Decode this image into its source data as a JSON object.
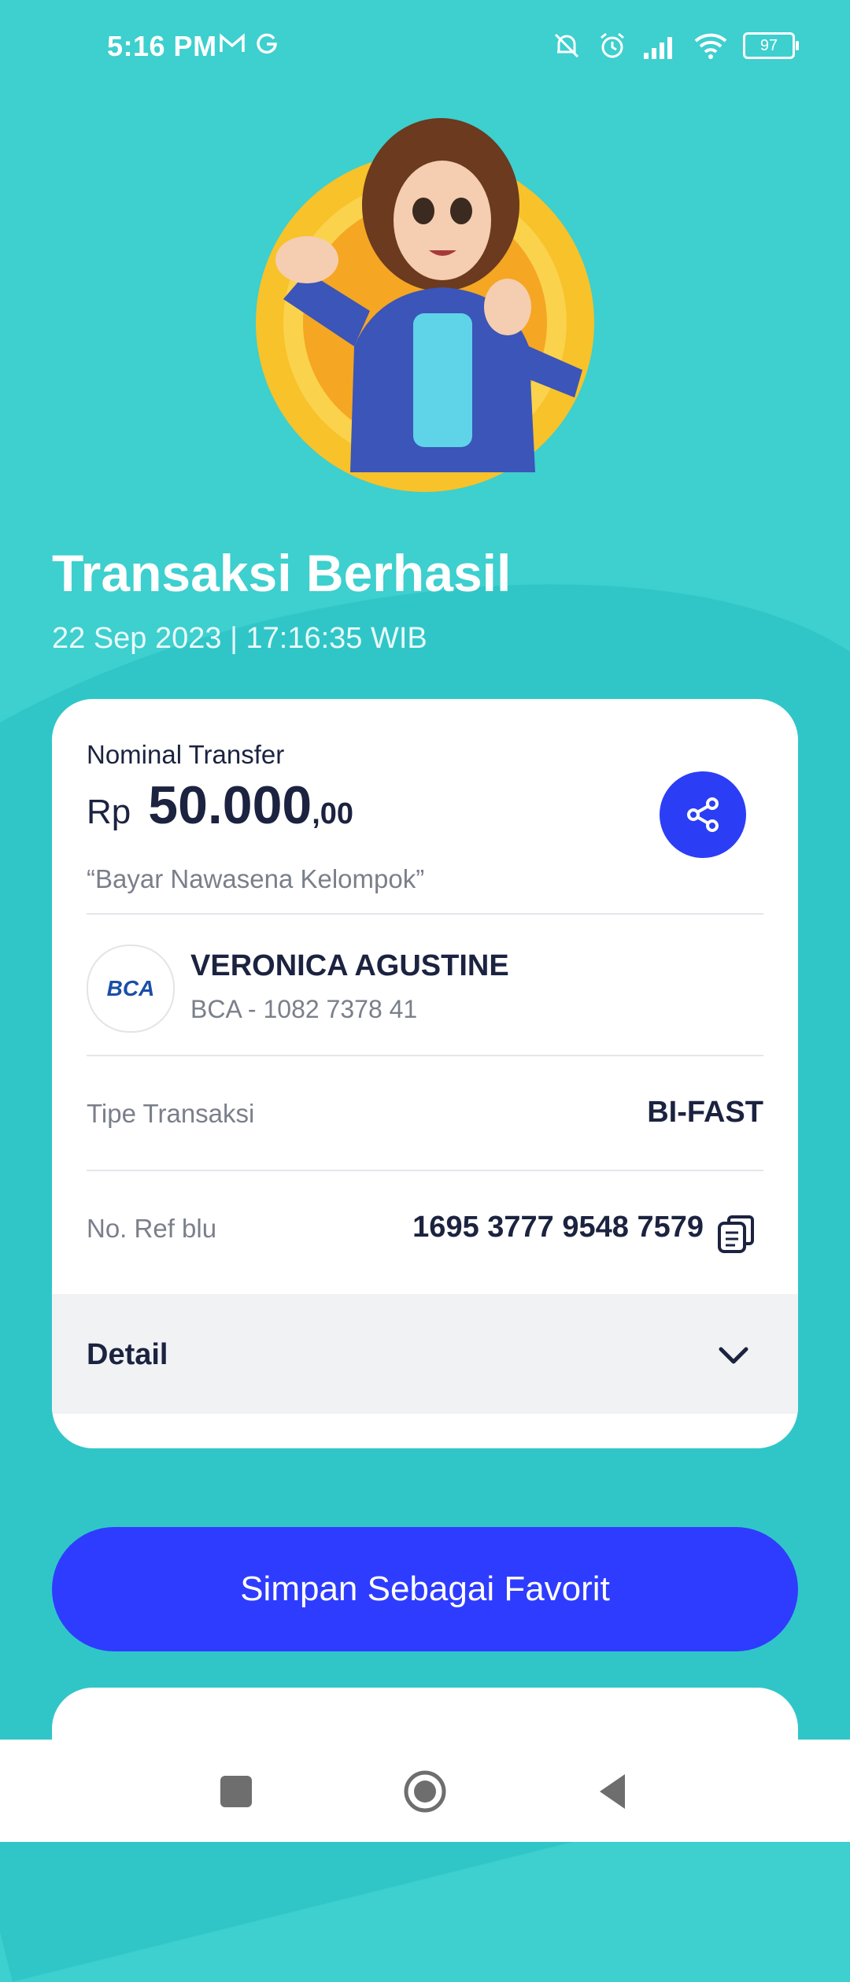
{
  "status_bar": {
    "time": "5:16 PM",
    "left_icons": [
      "gmail-icon",
      "g-icon"
    ],
    "right_icons": [
      "mute-icon",
      "alarm-icon",
      "signal-icon",
      "wifi-icon"
    ],
    "battery": "97"
  },
  "header": {
    "title": "Transaksi Berhasil",
    "datetime": "22 Sep 2023  |  17:16:35 WIB"
  },
  "card": {
    "amount_label": "Nominal Transfer",
    "amount_prefix": "Rp",
    "amount_main": "50.000",
    "amount_cents": ",00",
    "note": "“Bayar Nawasena Kelompok”",
    "recipient": {
      "bank_logo_text": "BCA",
      "name": "VERONICA AGUSTINE",
      "account": "BCA - 1082 7378 41"
    },
    "transaction_type_label": "Tipe Transaksi",
    "transaction_type_value": "BI-FAST",
    "ref_label": "No. Ref blu",
    "ref_value": "1695 3777 9548 7579",
    "detail_label": "Detail"
  },
  "actions": {
    "favorite_button": "Simpan Sebagai Favorit"
  },
  "colors": {
    "background": "#3ecfcf",
    "accent": "#2e3cff",
    "text_dark": "#1c2340"
  }
}
